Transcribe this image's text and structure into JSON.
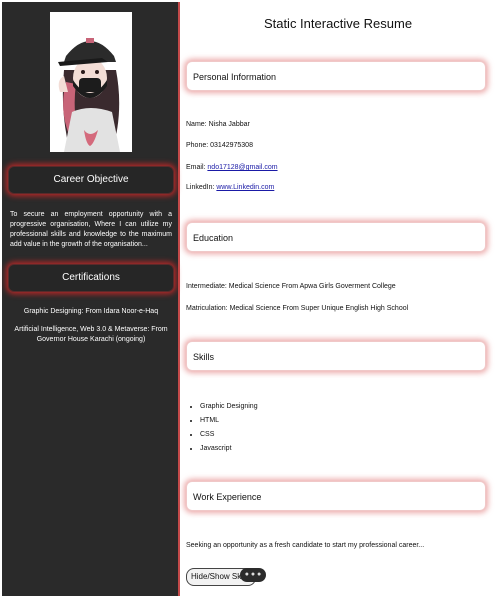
{
  "sidebar": {
    "career_objective": {
      "heading": "Career Objective",
      "text": "To secure an employment opportunity with a progressive organisation, Where I can utilize my professional skills and knowledge to the maximum add value in the growth of the organisation..."
    },
    "certifications": {
      "heading": "Certifications",
      "items": [
        "Graphic Designing: From Idara Noor-e-Haq",
        "Artificial Intelligence, Web 3.0 & Metaverse: From Governor House Karachi (ongoing)"
      ]
    }
  },
  "main": {
    "title": "Static Interactive Resume",
    "personal": {
      "heading": "Personal Information",
      "name_label": "Name:",
      "name": "Nisha Jabbar",
      "phone_label": "Phone:",
      "phone": "03142975308",
      "email_label": "Email:",
      "email": "ndo17128@gmail.com",
      "linkedin_label": "LinkedIn:",
      "linkedin": "www.Linkedin.com"
    },
    "education": {
      "heading": "Education",
      "items": [
        "Intermediate: Medical Science From Apwa Girls Goverment College",
        "Matriculation: Medical Science From Super Unique English High School"
      ]
    },
    "skills": {
      "heading": "Skills",
      "items": [
        "Graphic Designing",
        "HTML",
        "CSS",
        "Javascript"
      ]
    },
    "experience": {
      "heading": "Work Experience",
      "text": "Seeking an opportunity as a fresh candidate to start my professional career..."
    },
    "toggle_button": "Hide/Show Skills"
  },
  "colors": {
    "sidebar_bg": "#2a2a2a",
    "glow_red": "#d22828",
    "link": "#1a1aa6"
  },
  "icons": {
    "floating_toolbar": "ellipsis-icon"
  }
}
